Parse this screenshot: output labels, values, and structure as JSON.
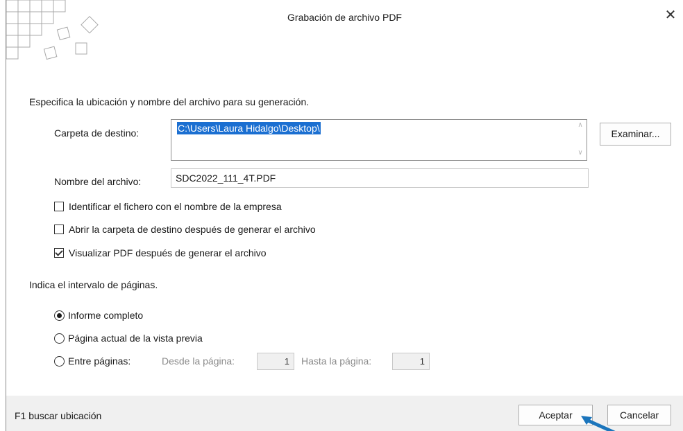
{
  "window": {
    "title": "Grabación de archivo PDF",
    "close_glyph": "✕"
  },
  "location": {
    "heading": "Especifica la ubicación y nombre del archivo para su generación.",
    "folder_label": "Carpeta de destino:",
    "folder_value": "C:\\Users\\Laura Hidalgo\\Desktop\\",
    "browse_button": "Examinar...",
    "filename_label": "Nombre del archivo:",
    "filename_value": "SDC2022_111_4T.PDF"
  },
  "options": [
    {
      "label": "Identificar el fichero con el nombre de la empresa",
      "checked": false
    },
    {
      "label": "Abrir la carpeta de destino después de generar el archivo",
      "checked": false
    },
    {
      "label": "Visualizar PDF después de generar el archivo",
      "checked": true
    }
  ],
  "range": {
    "heading": "Indica el intervalo de páginas.",
    "full_report": "Informe completo",
    "current_page": "Página actual de la vista previa",
    "between_pages": "Entre páginas:",
    "from_label": "Desde la página:",
    "from_value": "1",
    "to_label": "Hasta la página:",
    "to_value": "1",
    "selected": "full_report"
  },
  "footer": {
    "hint": "F1 buscar ubicación",
    "accept_button": "Aceptar",
    "cancel_button": "Cancelar"
  },
  "colors": {
    "selection": "#1b6fd1",
    "footer_bg": "#f0f0f0",
    "pointer_arrow": "#1b75bc"
  }
}
